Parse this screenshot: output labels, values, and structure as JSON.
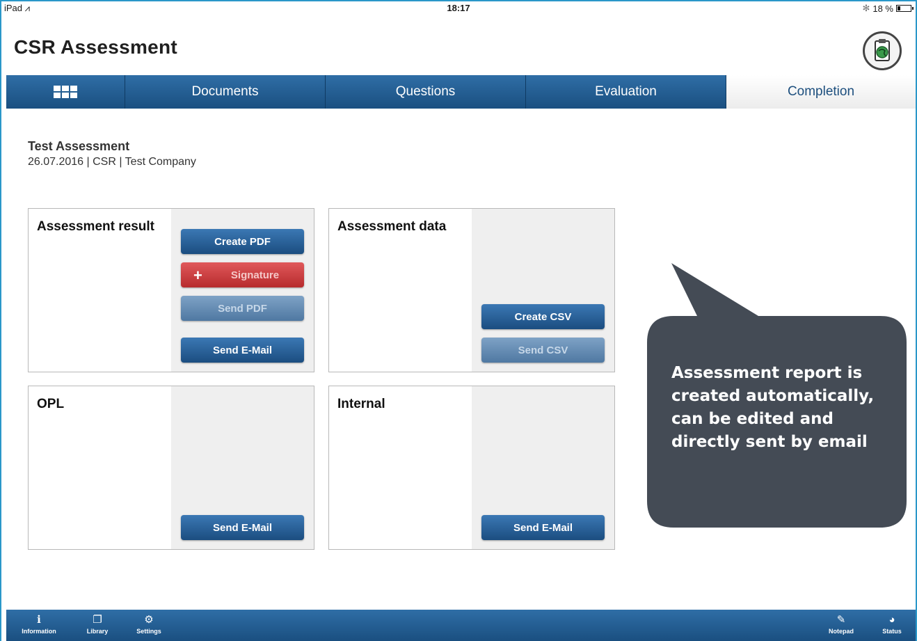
{
  "statusbar": {
    "device": "iPad",
    "time": "18:17",
    "battery": "18 %",
    "bluetooth": "✻"
  },
  "app": {
    "title": "CSR Assessment"
  },
  "tabs": [
    {
      "label": "Documents"
    },
    {
      "label": "Questions"
    },
    {
      "label": "Evaluation"
    },
    {
      "label": "Completion",
      "active": true
    }
  ],
  "assessment": {
    "title": "Test Assessment",
    "subtitle": "26.07.2016 | CSR | Test Company"
  },
  "cards": {
    "result": {
      "title": "Assessment result",
      "create_pdf": "Create PDF",
      "signature": "Signature",
      "send_pdf": "Send PDF",
      "send_email": "Send E-Mail"
    },
    "data": {
      "title": "Assessment data",
      "create_csv": "Create CSV",
      "send_csv": "Send CSV"
    },
    "opl": {
      "title": "OPL",
      "send_email": "Send E-Mail"
    },
    "internal": {
      "title": "Internal",
      "send_email": "Send E-Mail"
    }
  },
  "callout": {
    "text": "Assessment report is created automatically, can be edited and directly sent by email"
  },
  "bottombar": {
    "information": "Information",
    "library": "Library",
    "settings": "Settings",
    "notepad": "Notepad",
    "status": "Status"
  },
  "colors": {
    "nav_blue": "#1a4f80",
    "signature_red": "#c2393b",
    "callout_bg": "#444b55",
    "frame": "#2a97c9"
  }
}
